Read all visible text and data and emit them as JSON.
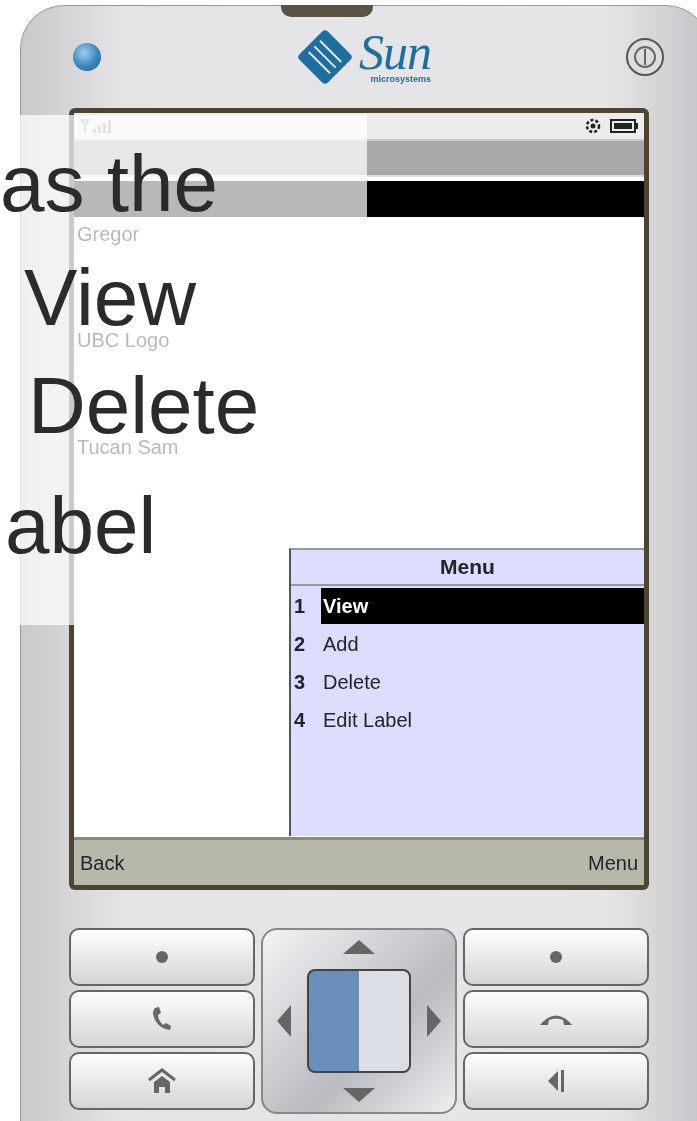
{
  "device": {
    "logo": "Sun",
    "logo_subtitle": "microsystems"
  },
  "screen": {
    "items": [
      {
        "selected": true
      },
      {
        "label": "Gregor",
        "selected": false
      },
      {
        "selected": false
      },
      {
        "selected": false
      },
      {
        "label": "UBC Logo",
        "selected": false
      },
      {
        "selected": false
      },
      {
        "selected": false
      },
      {
        "label": "Tucan Sam",
        "selected": false
      }
    ],
    "menu": {
      "title": "Menu",
      "items": [
        {
          "number": "1",
          "label": "View",
          "selected": true
        },
        {
          "number": "2",
          "label": "Add",
          "selected": false
        },
        {
          "number": "3",
          "label": "Delete",
          "selected": false
        },
        {
          "number": "4",
          "label": "Edit Label",
          "selected": false
        }
      ]
    },
    "softkeys": {
      "left": "Back",
      "right": "Menu"
    }
  },
  "overlay": {
    "lines": [
      "as the",
      "View",
      "Delete",
      "abel"
    ]
  }
}
